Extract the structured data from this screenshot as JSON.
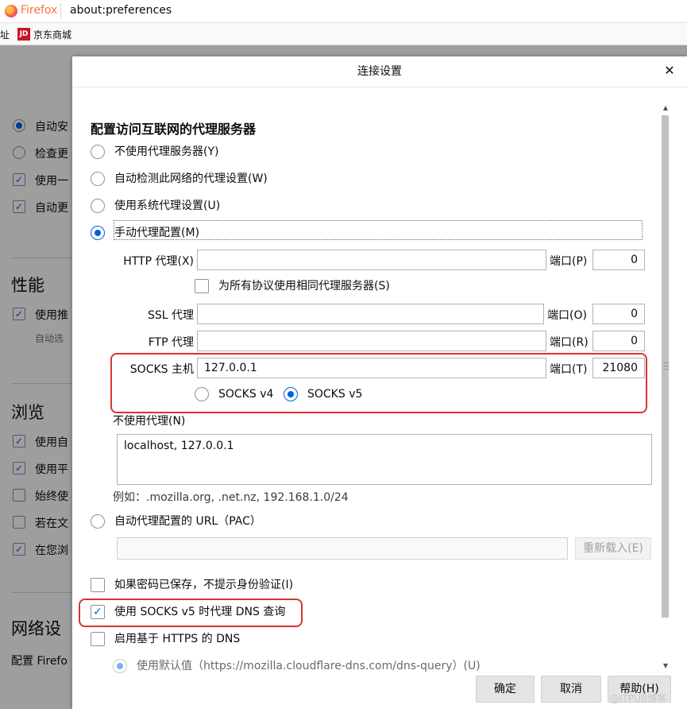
{
  "browser": {
    "app_name": "Firefox",
    "url": "about:preferences",
    "bookmarks": [
      {
        "label": "址"
      },
      {
        "icon_text": "JD",
        "label": "京东商城"
      }
    ]
  },
  "background_page": {
    "items_top": [
      {
        "label": "自动安",
        "control": "radio-on"
      },
      {
        "label": "检查更",
        "control": "radio"
      },
      {
        "label": "使用一",
        "control": "check-on"
      },
      {
        "label": "自动更",
        "control": "check-on"
      }
    ],
    "performance": {
      "heading": "性能",
      "item": "使用推",
      "sub": "自动选"
    },
    "browsing": {
      "heading": "浏览",
      "items": [
        {
          "label": "使用自",
          "checked": true
        },
        {
          "label": "使用平",
          "checked": true
        },
        {
          "label": "始终使",
          "checked": false
        },
        {
          "label": "若在文",
          "checked": false
        },
        {
          "label": "在您浏",
          "checked": true
        }
      ]
    },
    "network": {
      "heading": "网络设",
      "text": "配置 Firefo"
    }
  },
  "dialog": {
    "title": "连接设置",
    "section_title": "配置访问互联网的代理服务器",
    "proxy_options": {
      "none": "不使用代理服务器(Y)",
      "auto_detect": "自动检测此网络的代理设置(W)",
      "system": "使用系统代理设置(U)",
      "manual": "手动代理配置(M)"
    },
    "http_label": "HTTP 代理(X)",
    "http_value": "",
    "port_label_p": "端口(P)",
    "http_port": "0",
    "same_proxy_label": "为所有协议使用相同代理服务器(S)",
    "ssl_label": "SSL 代理",
    "ssl_value": "",
    "port_label_o": "端口(O)",
    "ssl_port": "0",
    "ftp_label": "FTP 代理",
    "ftp_value": "",
    "port_label_r": "端口(R)",
    "ftp_port": "0",
    "socks_label": "SOCKS 主机",
    "socks_value": "127.0.0.1",
    "port_label_t": "端口(T)",
    "socks_port": "21080",
    "socks_v4": "SOCKS v4",
    "socks_v5": "SOCKS v5",
    "no_proxy_label": "不使用代理(N)",
    "no_proxy_value": "localhost, 127.0.0.1",
    "example_hint": "例如：.mozilla.org, .net.nz, 192.168.1.0/24",
    "pac_label": "自动代理配置的 URL（PAC）",
    "pac_value": "",
    "reload_button": "重新载入(E)",
    "no_auth_prompt": "如果密码已保存，不提示身份验证(I)",
    "socks_dns": "使用 SOCKS v5 时代理 DNS 查询",
    "enable_doh": "启用基于 HTTPS 的 DNS",
    "doh_default": "使用默认值（https://mozilla.cloudflare-dns.com/dns-query）(U)"
  },
  "footer": {
    "ok": "确定",
    "cancel": "取消",
    "help": "帮助(H)"
  },
  "watermark": "@ITPUB博客",
  "colors": {
    "accent": "#0060df",
    "highlight_box": "#d9342f",
    "firefox_orange": "#ff7139"
  }
}
